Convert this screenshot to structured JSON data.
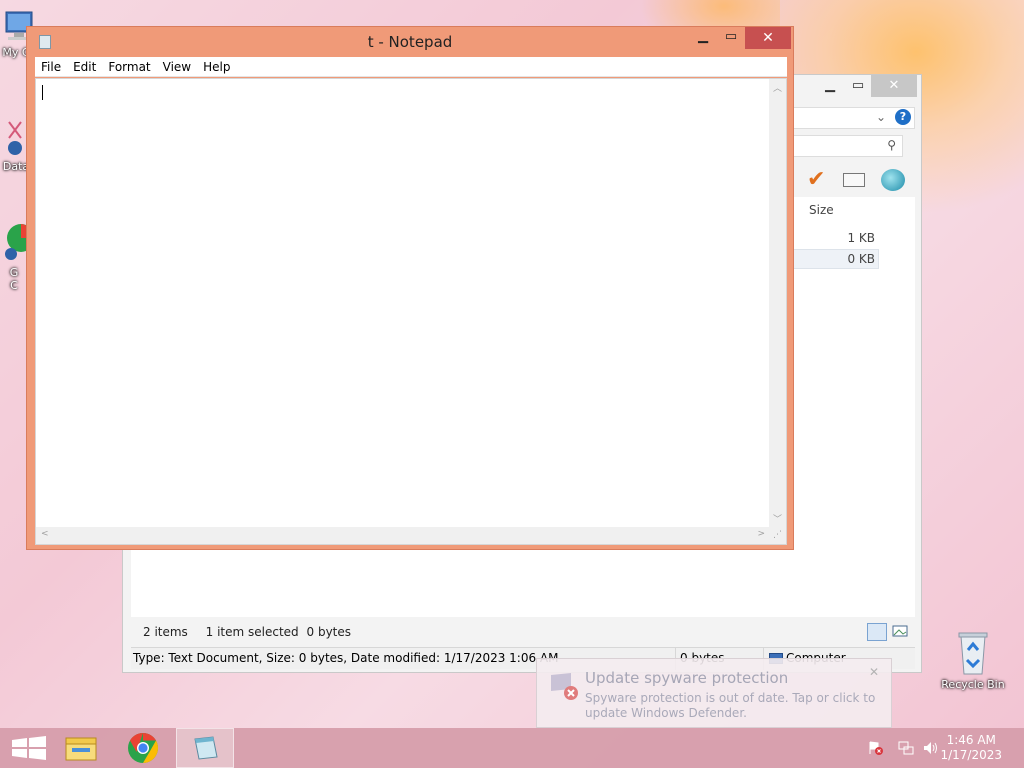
{
  "notepad": {
    "title": "t - Notepad",
    "menu": [
      "File",
      "Edit",
      "Format",
      "View",
      "Help"
    ],
    "content": ""
  },
  "explorer": {
    "column_size": "Size",
    "rows": [
      {
        "size": "1 KB"
      },
      {
        "size": "0 KB"
      }
    ],
    "status_items": "2 items",
    "status_selected": "1 item selected",
    "status_bytes": "0 bytes",
    "details": "Type: Text Document, Size: 0 bytes, Date modified: 1/17/2023 1:06 AM",
    "details_bytes": "0 bytes",
    "details_location": "Computer"
  },
  "desktop": {
    "icons": [
      {
        "label": "My C"
      },
      {
        "label": "Data"
      },
      {
        "label": "G\nC"
      },
      {
        "label": "Recycle Bin"
      }
    ]
  },
  "toast": {
    "title": "Update spyware protection",
    "body": "Spyware protection is out of date. Tap or click to update Windows Defender."
  },
  "taskbar": {
    "time": "1:46 AM",
    "date": "1/17/2023"
  },
  "colors": {
    "notepad_frame": "#f09a78",
    "close_red": "#c75050",
    "taskbar": "#d69eac"
  }
}
